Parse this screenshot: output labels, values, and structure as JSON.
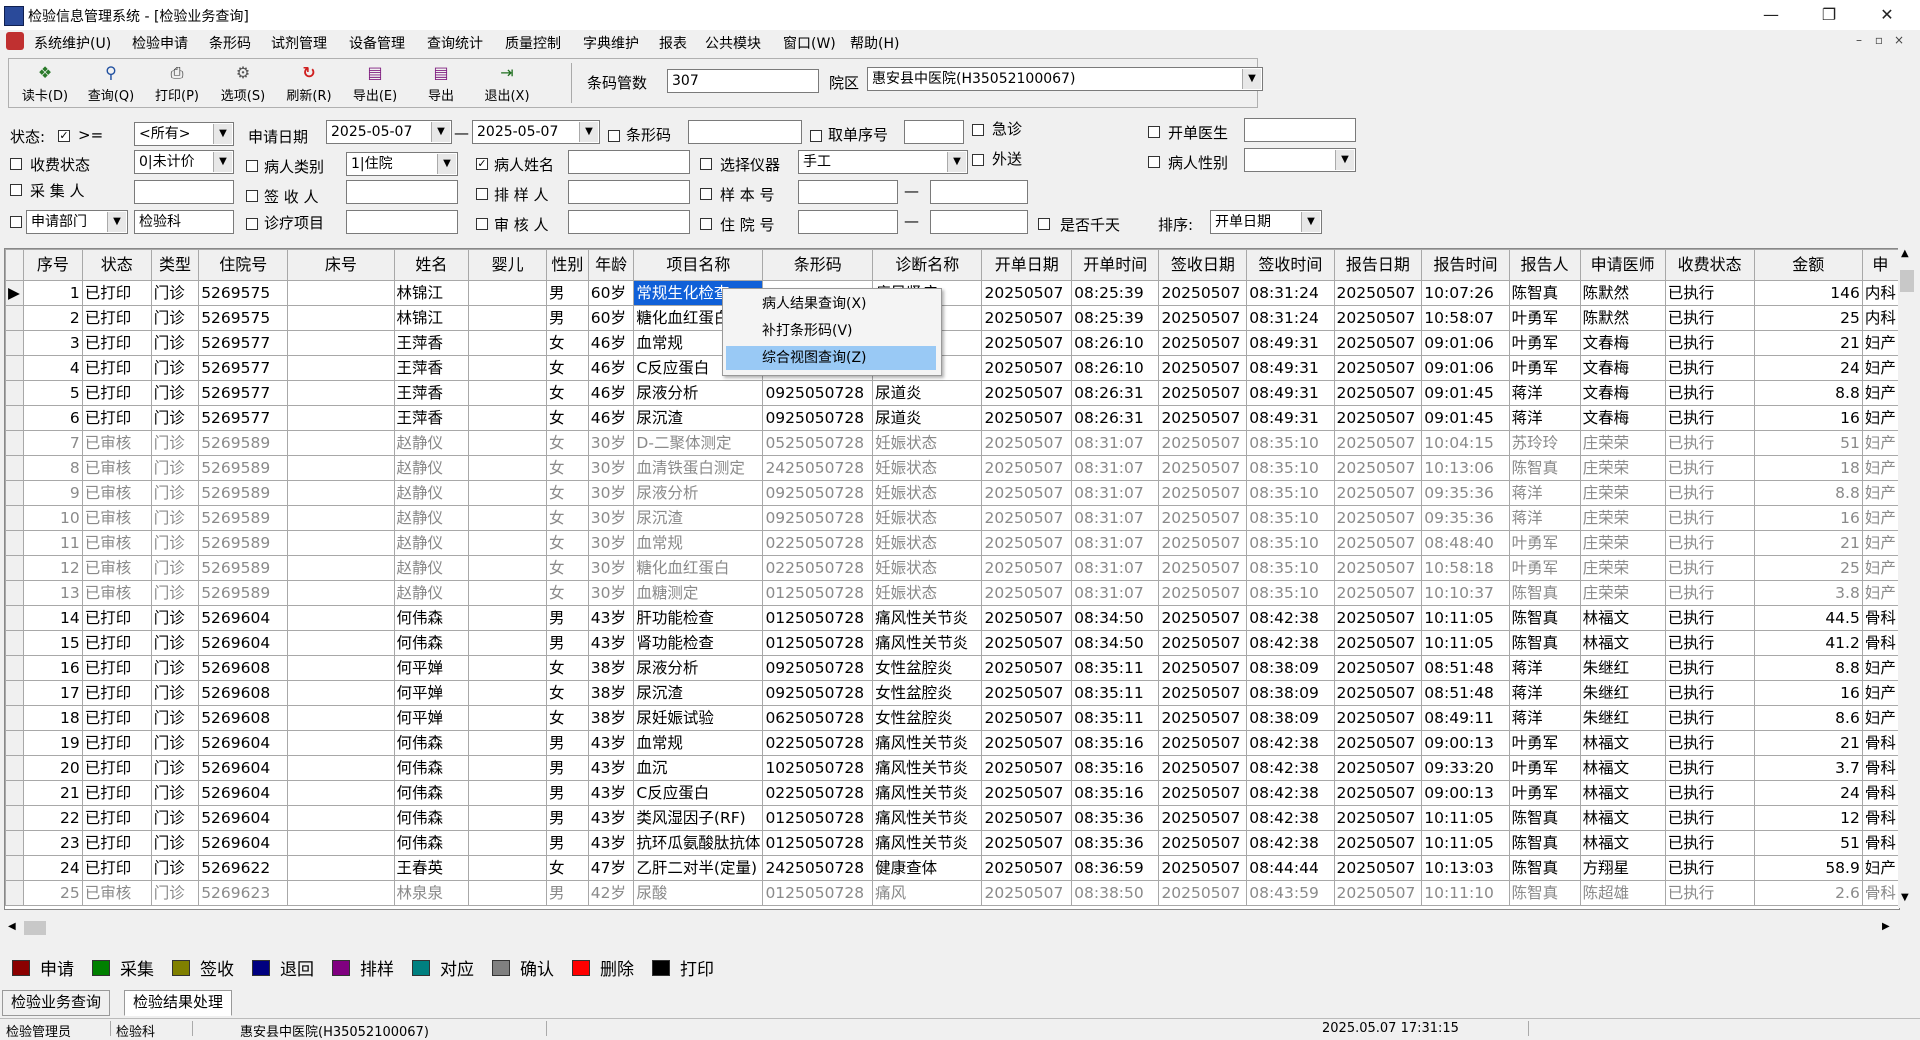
{
  "window": {
    "title": "检验信息管理系统 - [检验业务查询]",
    "minimize_glyph": "—",
    "restore_glyph": "❐",
    "close_glyph": "✕",
    "mdi_min": "–",
    "mdi_restore": "▫",
    "mdi_close": "×"
  },
  "menu": [
    "系统维护(U)",
    "检验申请",
    "条形码",
    "试剂管理",
    "设备管理",
    "查询统计",
    "质量控制",
    "字典维护",
    "报表",
    "公共模块",
    "窗口(W)",
    "帮助(H)"
  ],
  "toolbar": {
    "buttons": [
      {
        "label": "读卡(D)",
        "icon": "card-reader-icon",
        "glyph": "❖"
      },
      {
        "label": "查询(Q)",
        "icon": "magnifier-icon",
        "glyph": "⚲"
      },
      {
        "label": "打印(P)",
        "icon": "printer-icon",
        "glyph": "⎙"
      },
      {
        "label": "选项(S)",
        "icon": "options-icon",
        "glyph": "⚙"
      },
      {
        "label": "刷新(R)",
        "icon": "refresh-icon",
        "glyph": "↻"
      },
      {
        "label": "导出(E)",
        "icon": "export-book-icon",
        "glyph": "▤"
      },
      {
        "label": "导出",
        "icon": "export-book-icon",
        "glyph": "▤"
      },
      {
        "label": "退出(X)",
        "icon": "exit-door-icon",
        "glyph": "⇥"
      }
    ],
    "barcode_count_label": "条码管数",
    "barcode_count_value": "307",
    "campus_label": "院区",
    "campus_value": "惠安县中医院(H35052100067)"
  },
  "filters": {
    "status_label": "状态:",
    "status_op": ">=",
    "status_value": "<所有>",
    "apply_date_label": "申请日期",
    "date_from": "2025-05-07",
    "date_to": "2025-05-07",
    "date_dash": "—",
    "barcode_label": "条形码",
    "pickup_no_label": "取单序号",
    "urgent_label": "急诊",
    "doctor_label": "开单医生",
    "fee_status_label": "收费状态",
    "fee_status_value": "0|未计价",
    "patient_type_label": "病人类别",
    "patient_type_value": "1|住院",
    "patient_name_label": "病人姓名",
    "instrument_label": "选择仪器",
    "instrument_value": "手工",
    "outside_label": "外送",
    "patient_sex_label": "病人性别",
    "collector_label": "采 集 人",
    "signer_label": "签 收 人",
    "sorter_label": "排 样 人",
    "sample_no_label": "样 本 号",
    "range_dash": "—",
    "dept_label": "申请部门",
    "dept_value": "检验科",
    "project_label": "诊疗项目",
    "auditor_label": "审 核 人",
    "inpatient_no_label": "住 院 号",
    "thousand_days_label": "是否千天",
    "sort_label": "排序:",
    "sort_value": "开单日期"
  },
  "grid": {
    "columns": [
      "序号",
      "状态",
      "类型",
      "住院号",
      "床号",
      "姓名",
      "婴儿",
      "性别",
      "年龄",
      "项目名称",
      "条形码",
      "诊断名称",
      "开单日期",
      "开单时间",
      "签收日期",
      "签收时间",
      "报告日期",
      "报告时间",
      "报告人",
      "申请医师",
      "收费状态",
      "金额",
      "申"
    ],
    "rows": [
      [
        "1",
        "已打印",
        "门诊",
        "5269575",
        "",
        "林锦江",
        "",
        "男",
        "60岁",
        "常规生化检查",
        "",
        "痛风肾病",
        "20250507",
        "08:25:39",
        "20250507",
        "08:31:24",
        "20250507",
        "10:07:26",
        "陈智真",
        "陈默然",
        "已执行",
        "146",
        "内科"
      ],
      [
        "2",
        "已打印",
        "门诊",
        "5269575",
        "",
        "林锦江",
        "",
        "男",
        "60岁",
        "糖化血红蛋白",
        "",
        "痛风肾病",
        "20250507",
        "08:25:39",
        "20250507",
        "08:31:24",
        "20250507",
        "10:58:07",
        "叶勇军",
        "陈默然",
        "已执行",
        "25",
        "内科"
      ],
      [
        "3",
        "已打印",
        "门诊",
        "5269577",
        "",
        "王萍香",
        "",
        "女",
        "46岁",
        "血常规",
        "",
        "",
        "20250507",
        "08:26:10",
        "20250507",
        "08:49:31",
        "20250507",
        "09:01:06",
        "叶勇军",
        "文春梅",
        "已执行",
        "21",
        "妇产"
      ],
      [
        "4",
        "已打印",
        "门诊",
        "5269577",
        "",
        "王萍香",
        "",
        "女",
        "46岁",
        "C反应蛋白",
        "",
        "",
        "20250507",
        "08:26:10",
        "20250507",
        "08:49:31",
        "20250507",
        "09:01:06",
        "叶勇军",
        "文春梅",
        "已执行",
        "24",
        "妇产"
      ],
      [
        "5",
        "已打印",
        "门诊",
        "5269577",
        "",
        "王萍香",
        "",
        "女",
        "46岁",
        "尿液分析",
        "0925050728",
        "尿道炎",
        "20250507",
        "08:26:31",
        "20250507",
        "08:49:31",
        "20250507",
        "09:01:45",
        "蒋洋",
        "文春梅",
        "已执行",
        "8.8",
        "妇产"
      ],
      [
        "6",
        "已打印",
        "门诊",
        "5269577",
        "",
        "王萍香",
        "",
        "女",
        "46岁",
        "尿沉渣",
        "0925050728",
        "尿道炎",
        "20250507",
        "08:26:31",
        "20250507",
        "08:49:31",
        "20250507",
        "09:01:45",
        "蒋洋",
        "文春梅",
        "已执行",
        "16",
        "妇产"
      ],
      [
        "7",
        "已审核",
        "门诊",
        "5269589",
        "",
        "赵静仪",
        "",
        "女",
        "30岁",
        "D-二聚体测定",
        "0525050728",
        "妊娠状态",
        "20250507",
        "08:31:07",
        "20250507",
        "08:35:10",
        "20250507",
        "10:04:15",
        "苏玲玲",
        "庄荣荣",
        "已执行",
        "51",
        "妇产"
      ],
      [
        "8",
        "已审核",
        "门诊",
        "5269589",
        "",
        "赵静仪",
        "",
        "女",
        "30岁",
        "血清铁蛋白测定",
        "2425050728",
        "妊娠状态",
        "20250507",
        "08:31:07",
        "20250507",
        "08:35:10",
        "20250507",
        "10:13:06",
        "陈智真",
        "庄荣荣",
        "已执行",
        "18",
        "妇产"
      ],
      [
        "9",
        "已审核",
        "门诊",
        "5269589",
        "",
        "赵静仪",
        "",
        "女",
        "30岁",
        "尿液分析",
        "0925050728",
        "妊娠状态",
        "20250507",
        "08:31:07",
        "20250507",
        "08:35:10",
        "20250507",
        "09:35:36",
        "蒋洋",
        "庄荣荣",
        "已执行",
        "8.8",
        "妇产"
      ],
      [
        "10",
        "已审核",
        "门诊",
        "5269589",
        "",
        "赵静仪",
        "",
        "女",
        "30岁",
        "尿沉渣",
        "0925050728",
        "妊娠状态",
        "20250507",
        "08:31:07",
        "20250507",
        "08:35:10",
        "20250507",
        "09:35:36",
        "蒋洋",
        "庄荣荣",
        "已执行",
        "16",
        "妇产"
      ],
      [
        "11",
        "已审核",
        "门诊",
        "5269589",
        "",
        "赵静仪",
        "",
        "女",
        "30岁",
        "血常规",
        "0225050728",
        "妊娠状态",
        "20250507",
        "08:31:07",
        "20250507",
        "08:35:10",
        "20250507",
        "08:48:40",
        "叶勇军",
        "庄荣荣",
        "已执行",
        "21",
        "妇产"
      ],
      [
        "12",
        "已审核",
        "门诊",
        "5269589",
        "",
        "赵静仪",
        "",
        "女",
        "30岁",
        "糖化血红蛋白",
        "0225050728",
        "妊娠状态",
        "20250507",
        "08:31:07",
        "20250507",
        "08:35:10",
        "20250507",
        "10:58:18",
        "叶勇军",
        "庄荣荣",
        "已执行",
        "25",
        "妇产"
      ],
      [
        "13",
        "已审核",
        "门诊",
        "5269589",
        "",
        "赵静仪",
        "",
        "女",
        "30岁",
        "血糖测定",
        "0125050728",
        "妊娠状态",
        "20250507",
        "08:31:07",
        "20250507",
        "08:35:10",
        "20250507",
        "10:10:37",
        "陈智真",
        "庄荣荣",
        "已执行",
        "3.8",
        "妇产"
      ],
      [
        "14",
        "已打印",
        "门诊",
        "5269604",
        "",
        "何伟森",
        "",
        "男",
        "43岁",
        "肝功能检查",
        "0125050728",
        "痛风性关节炎",
        "20250507",
        "08:34:50",
        "20250507",
        "08:42:38",
        "20250507",
        "10:11:05",
        "陈智真",
        "林福文",
        "已执行",
        "44.5",
        "骨科"
      ],
      [
        "15",
        "已打印",
        "门诊",
        "5269604",
        "",
        "何伟森",
        "",
        "男",
        "43岁",
        "肾功能检查",
        "0125050728",
        "痛风性关节炎",
        "20250507",
        "08:34:50",
        "20250507",
        "08:42:38",
        "20250507",
        "10:11:05",
        "陈智真",
        "林福文",
        "已执行",
        "41.2",
        "骨科"
      ],
      [
        "16",
        "已打印",
        "门诊",
        "5269608",
        "",
        "何平婵",
        "",
        "女",
        "38岁",
        "尿液分析",
        "0925050728",
        "女性盆腔炎",
        "20250507",
        "08:35:11",
        "20250507",
        "08:38:09",
        "20250507",
        "08:51:48",
        "蒋洋",
        "朱继红",
        "已执行",
        "8.8",
        "妇产"
      ],
      [
        "17",
        "已打印",
        "门诊",
        "5269608",
        "",
        "何平婵",
        "",
        "女",
        "38岁",
        "尿沉渣",
        "0925050728",
        "女性盆腔炎",
        "20250507",
        "08:35:11",
        "20250507",
        "08:38:09",
        "20250507",
        "08:51:48",
        "蒋洋",
        "朱继红",
        "已执行",
        "16",
        "妇产"
      ],
      [
        "18",
        "已打印",
        "门诊",
        "5269608",
        "",
        "何平婵",
        "",
        "女",
        "38岁",
        "尿妊娠试验",
        "0625050728",
        "女性盆腔炎",
        "20250507",
        "08:35:11",
        "20250507",
        "08:38:09",
        "20250507",
        "08:49:11",
        "蒋洋",
        "朱继红",
        "已执行",
        "8.6",
        "妇产"
      ],
      [
        "19",
        "已打印",
        "门诊",
        "5269604",
        "",
        "何伟森",
        "",
        "男",
        "43岁",
        "血常规",
        "0225050728",
        "痛风性关节炎",
        "20250507",
        "08:35:16",
        "20250507",
        "08:42:38",
        "20250507",
        "09:00:13",
        "叶勇军",
        "林福文",
        "已执行",
        "21",
        "骨科"
      ],
      [
        "20",
        "已打印",
        "门诊",
        "5269604",
        "",
        "何伟森",
        "",
        "男",
        "43岁",
        "血沉",
        "1025050728",
        "痛风性关节炎",
        "20250507",
        "08:35:16",
        "20250507",
        "08:42:38",
        "20250507",
        "09:33:20",
        "叶勇军",
        "林福文",
        "已执行",
        "3.7",
        "骨科"
      ],
      [
        "21",
        "已打印",
        "门诊",
        "5269604",
        "",
        "何伟森",
        "",
        "男",
        "43岁",
        "C反应蛋白",
        "0225050728",
        "痛风性关节炎",
        "20250507",
        "08:35:16",
        "20250507",
        "08:42:38",
        "20250507",
        "09:00:13",
        "叶勇军",
        "林福文",
        "已执行",
        "24",
        "骨科"
      ],
      [
        "22",
        "已打印",
        "门诊",
        "5269604",
        "",
        "何伟森",
        "",
        "男",
        "43岁",
        "类风湿因子(RF)",
        "0125050728",
        "痛风性关节炎",
        "20250507",
        "08:35:36",
        "20250507",
        "08:42:38",
        "20250507",
        "10:11:05",
        "陈智真",
        "林福文",
        "已执行",
        "12",
        "骨科"
      ],
      [
        "23",
        "已打印",
        "门诊",
        "5269604",
        "",
        "何伟森",
        "",
        "男",
        "43岁",
        "抗环瓜氨酸肽抗体",
        "0125050728",
        "痛风性关节炎",
        "20250507",
        "08:35:36",
        "20250507",
        "08:42:38",
        "20250507",
        "10:11:05",
        "陈智真",
        "林福文",
        "已执行",
        "51",
        "骨科"
      ],
      [
        "24",
        "已打印",
        "门诊",
        "5269622",
        "",
        "王春英",
        "",
        "女",
        "47岁",
        "乙肝二对半(定量)",
        "2425050728",
        "健康查体",
        "20250507",
        "08:36:59",
        "20250507",
        "08:44:44",
        "20250507",
        "10:13:03",
        "陈智真",
        "方翔星",
        "已执行",
        "58.9",
        "妇产"
      ],
      [
        "25",
        "已审核",
        "门诊",
        "5269623",
        "",
        "林泉泉",
        "",
        "男",
        "42岁",
        "尿酸",
        "0125050728",
        "痛风",
        "20250507",
        "08:38:50",
        "20250507",
        "08:43:59",
        "20250507",
        "10:11:10",
        "陈智真",
        "陈超雄",
        "已执行",
        "2.6",
        "骨科"
      ]
    ]
  },
  "context_menu": [
    "病人结果查询(X)",
    "补打条形码(V)",
    "综合视图查询(Z)"
  ],
  "legend": [
    {
      "label": "申请",
      "color": "#8b0000"
    },
    {
      "label": "采集",
      "color": "#008000"
    },
    {
      "label": "签收",
      "color": "#808000"
    },
    {
      "label": "退回",
      "color": "#000080"
    },
    {
      "label": "排样",
      "color": "#800080"
    },
    {
      "label": "对应",
      "color": "#008080"
    },
    {
      "label": "确认",
      "color": "#808080"
    },
    {
      "label": "删除",
      "color": "#ff0000"
    },
    {
      "label": "打印",
      "color": "#000000"
    }
  ],
  "tabs": [
    "检验业务查询",
    "检验结果处理"
  ],
  "statusbar": {
    "user": "检验管理员",
    "dept": "检验科",
    "hospital": "惠安县中医院(H35052100067)",
    "datetime": "2025.05.07 17:31:15"
  },
  "scroll": {
    "up": "▲",
    "down": "▼",
    "left": "◀",
    "right": "▶"
  }
}
